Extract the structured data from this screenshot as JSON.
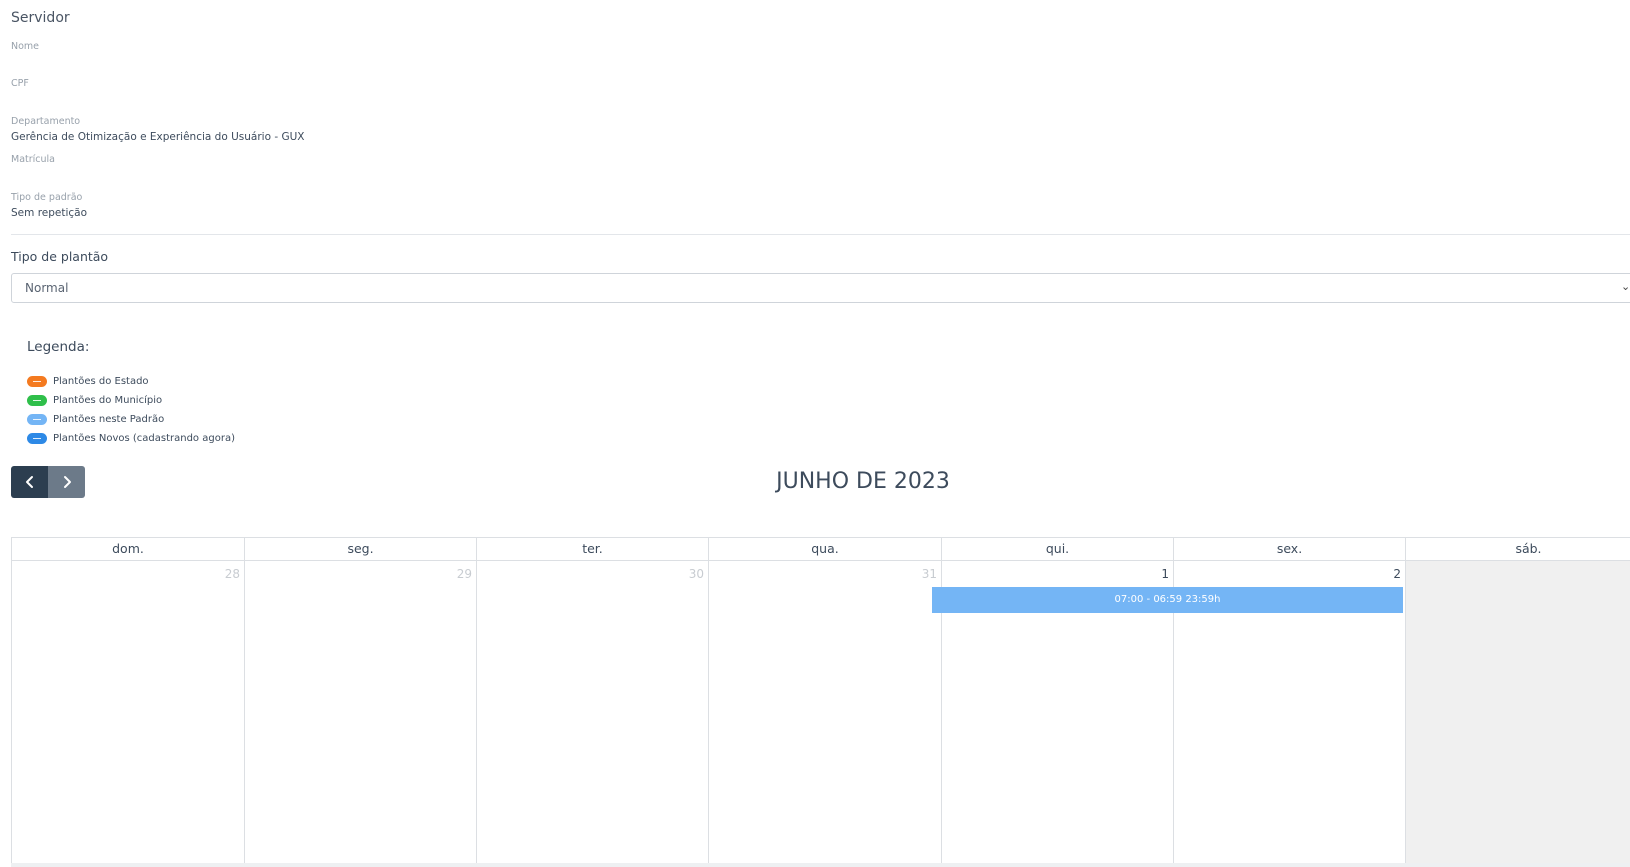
{
  "servidor": {
    "title": "Servidor",
    "fields": [
      {
        "label": "Nome",
        "value": ""
      },
      {
        "label": "CPF",
        "value": ""
      },
      {
        "label": "Departamento",
        "value": "Gerência de Otimização e Experiência do Usuário - GUX"
      },
      {
        "label": "Matrícula",
        "value": ""
      },
      {
        "label": "Tipo de padrão",
        "value": "Sem repetição"
      }
    ]
  },
  "plantao": {
    "label": "Tipo de plantão",
    "selected": "Normal"
  },
  "legend": {
    "title": "Legenda:",
    "items": [
      {
        "label": "Plantões do Estado",
        "color": "#f47a20"
      },
      {
        "label": "Plantões do Município",
        "color": "#2fbf4a"
      },
      {
        "label": "Plantões neste Padrão",
        "color": "#74b5f5"
      },
      {
        "label": "Plantões Novos (cadastrando agora)",
        "color": "#2d89e6"
      }
    ]
  },
  "calendar": {
    "title": "JUNHO DE 2023",
    "prev_icon": "chevron-left-icon",
    "next_icon": "chevron-right-icon",
    "weekdays": [
      "dom.",
      "seg.",
      "ter.",
      "qua.",
      "qui.",
      "sex.",
      "sáb."
    ],
    "days": [
      {
        "num": "28",
        "other": true
      },
      {
        "num": "29",
        "other": true
      },
      {
        "num": "30",
        "other": true
      },
      {
        "num": "31",
        "other": true
      },
      {
        "num": "1",
        "other": false
      },
      {
        "num": "2",
        "other": false
      },
      {
        "num": "",
        "other": false
      }
    ],
    "event": {
      "label": "07:00 - 06:59 23:59h",
      "color": "#74b5f5"
    }
  }
}
